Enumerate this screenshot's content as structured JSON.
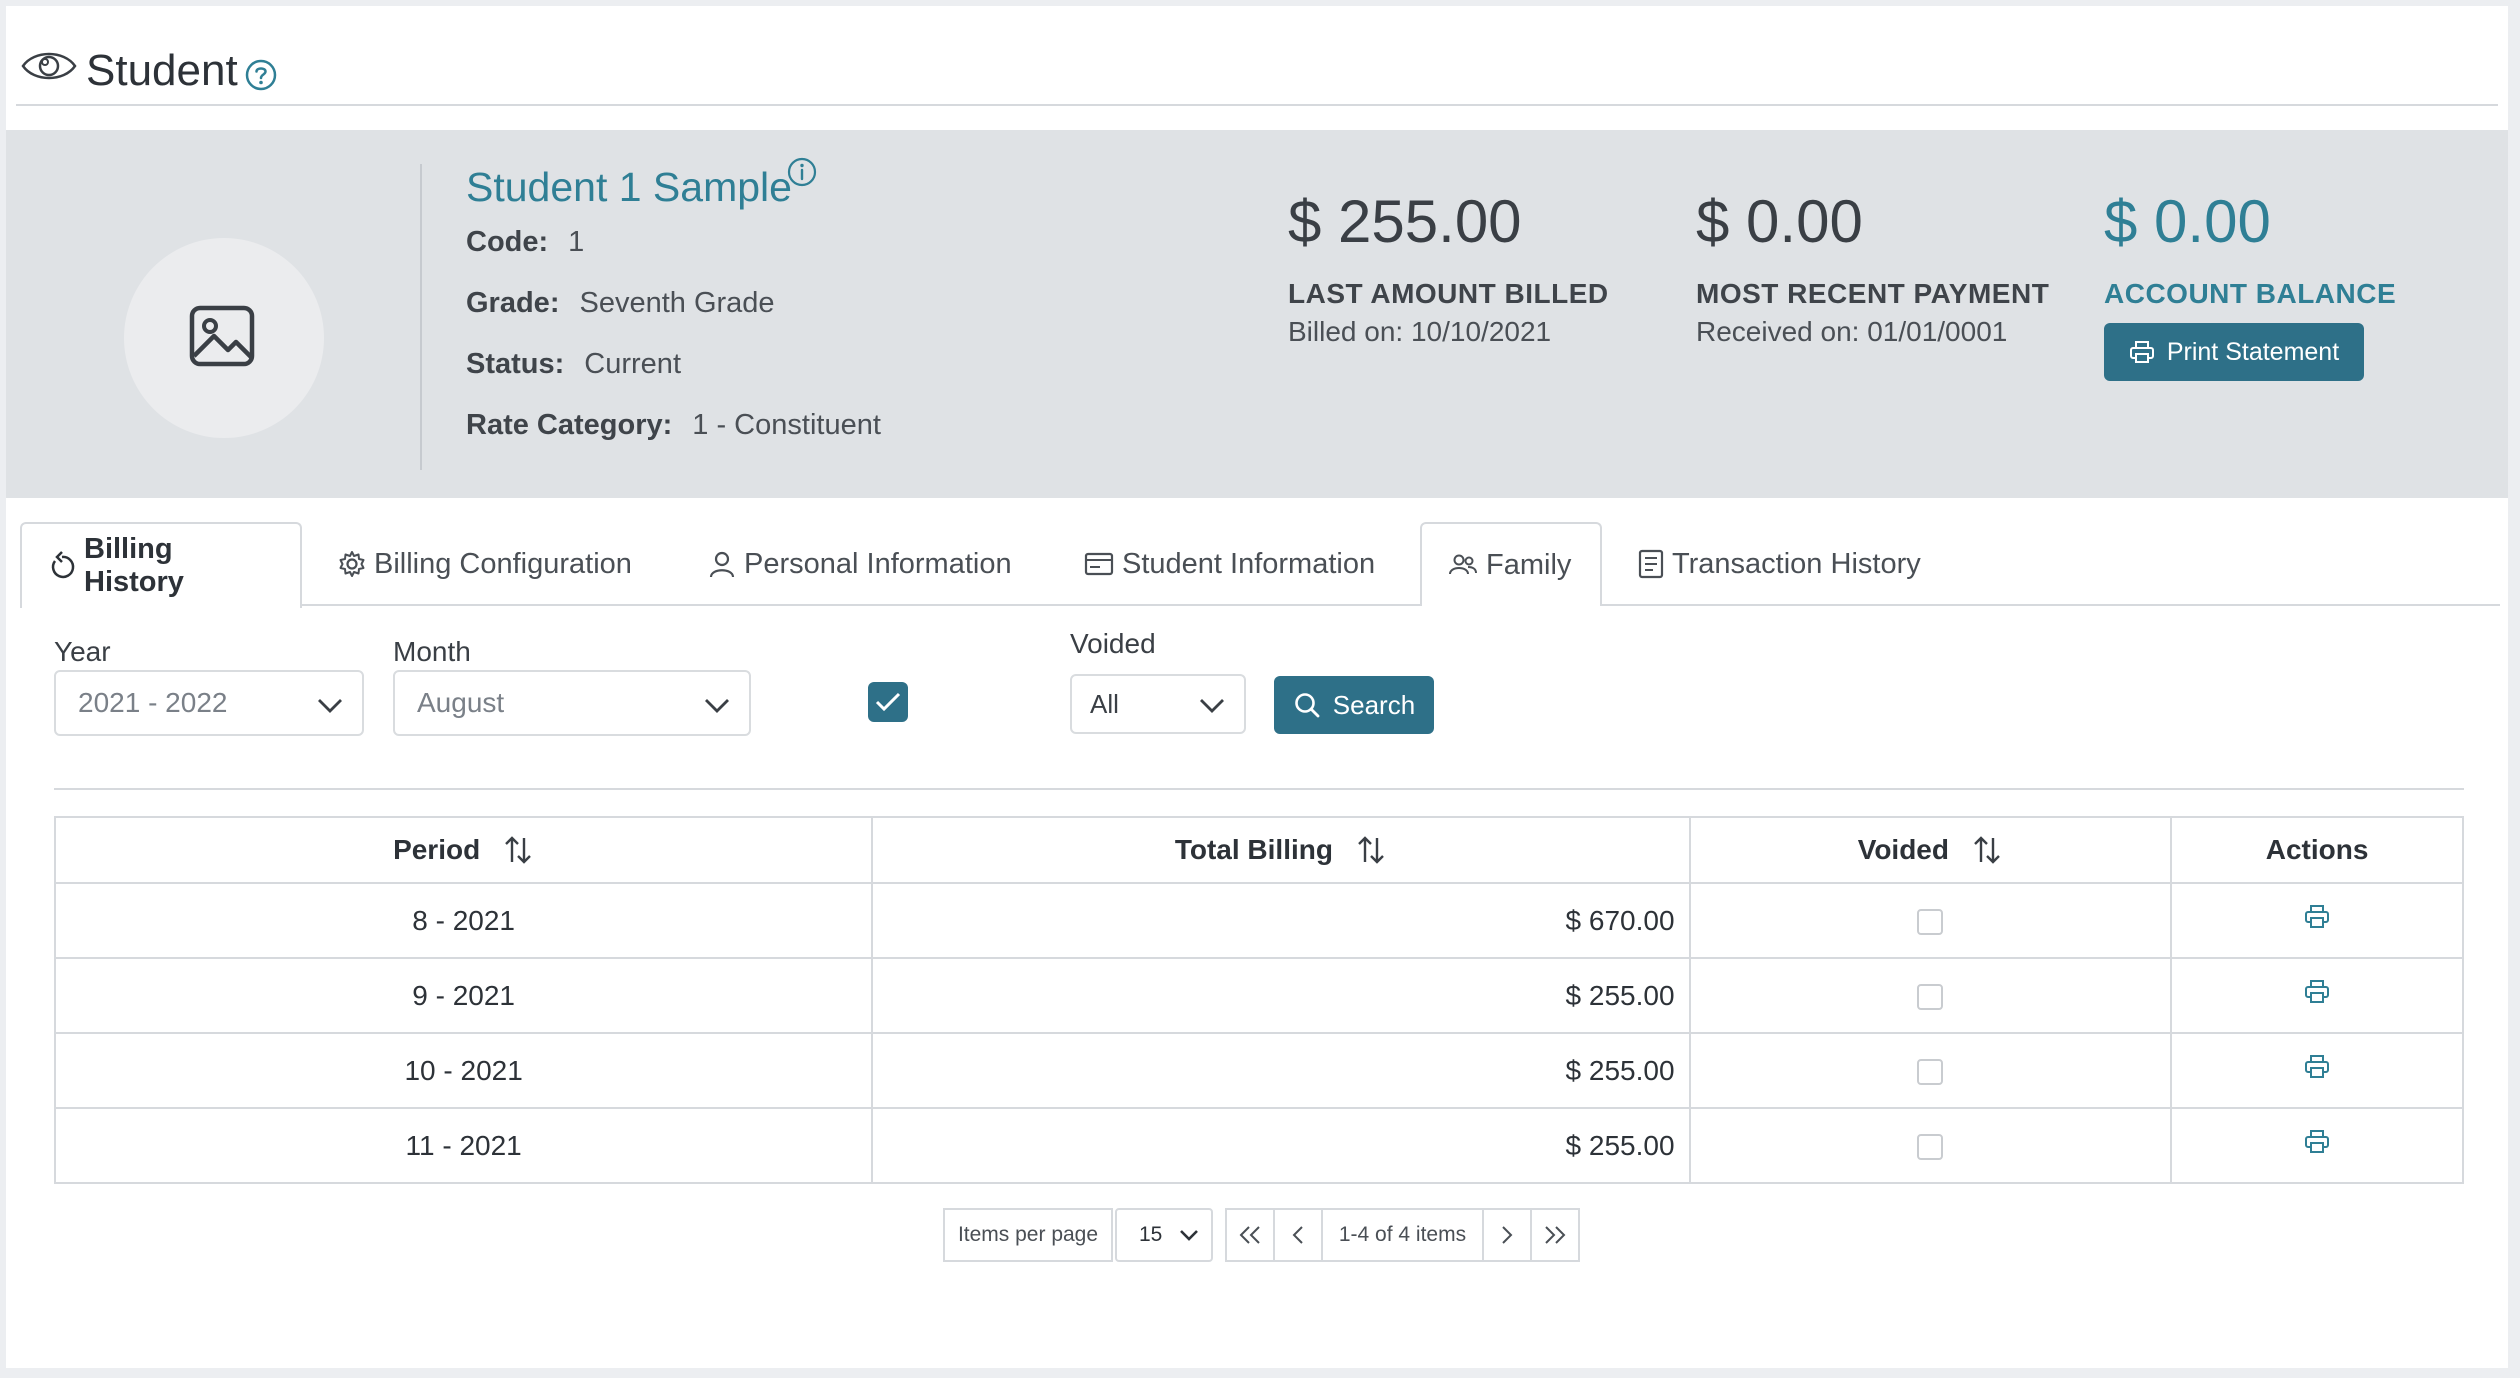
{
  "header": {
    "title": "Student"
  },
  "student": {
    "name": "Student 1 Sample",
    "fields": [
      {
        "label": "Code:",
        "value": "1"
      },
      {
        "label": "Grade:",
        "value": "Seventh Grade"
      },
      {
        "label": "Status:",
        "value": "Current"
      },
      {
        "label": "Rate Category:",
        "value": "1 - Constituent"
      }
    ]
  },
  "stats": [
    {
      "amount": "$ 255.00",
      "label": "LAST AMOUNT BILLED",
      "sub": "Billed on: 10/10/2021"
    },
    {
      "amount": "$ 0.00",
      "label": "MOST RECENT PAYMENT",
      "sub": "Received on: 01/01/0001"
    },
    {
      "amount": "$ 0.00",
      "label": "ACCOUNT BALANCE",
      "sub": ""
    }
  ],
  "print_statement_label": "Print Statement",
  "tabs": [
    {
      "label": "Billing History",
      "icon": "history-icon"
    },
    {
      "label": "Billing Configuration",
      "icon": "gear-icon"
    },
    {
      "label": "Personal Information",
      "icon": "person-icon"
    },
    {
      "label": "Student Information",
      "icon": "id-card-icon"
    },
    {
      "label": "Family",
      "icon": "family-icon"
    },
    {
      "label": "Transaction History",
      "icon": "document-icon"
    }
  ],
  "filters": {
    "year_label": "Year",
    "year_value": "2021 - 2022",
    "month_label": "Month",
    "month_value": "August",
    "voided_label": "Voided",
    "voided_value": "All",
    "search_label": "Search"
  },
  "table": {
    "columns": [
      "Period",
      "Total Billing",
      "Voided",
      "Actions"
    ],
    "rows": [
      {
        "period": "8 - 2021",
        "total": "$ 670.00"
      },
      {
        "period": "9 - 2021",
        "total": "$ 255.00"
      },
      {
        "period": "10 - 2021",
        "total": "$ 255.00"
      },
      {
        "period": "11 - 2021",
        "total": "$ 255.00"
      }
    ]
  },
  "pager": {
    "items_per_page_label": "Items per page",
    "page_size": "15",
    "range_text": "1-4 of 4 items"
  },
  "colors": {
    "accent": "#2f7f95",
    "button": "#2e7088",
    "band": "#dfe2e5"
  }
}
